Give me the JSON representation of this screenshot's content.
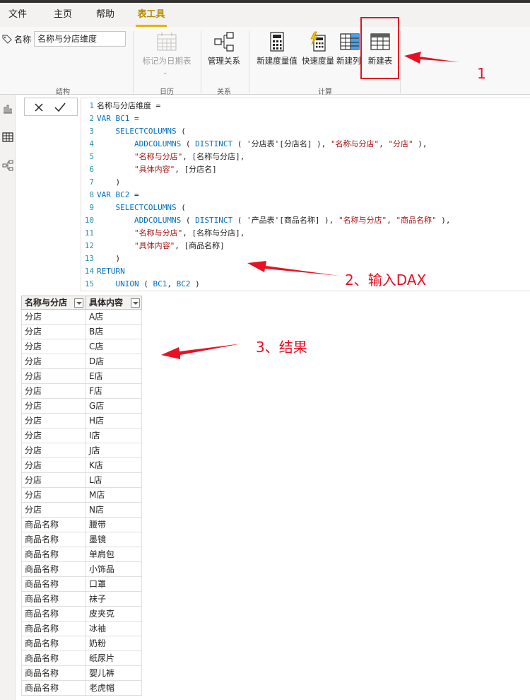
{
  "tabs": [
    {
      "label": "文件"
    },
    {
      "label": "主页"
    },
    {
      "label": "帮助"
    },
    {
      "label": "表工具"
    }
  ],
  "ribbon": {
    "name_label": "名称",
    "name_value": "名称与分店维度",
    "buttons": {
      "mark_date_table": "标记为日期表",
      "manage_relations": "管理关系",
      "new_measure": "新建度量值",
      "quick_measure": "快速度量",
      "new_column": "新建列",
      "new_table": "新建表"
    },
    "groups": {
      "structure": "结构",
      "calendar": "日历",
      "relations": "关系",
      "calc": "计算"
    }
  },
  "editor": {
    "lines": [
      {
        "n": "1",
        "text": "名称与分店维度 ="
      },
      {
        "n": "2",
        "text": "VAR BC1 ="
      },
      {
        "n": "3",
        "text": "    SELECTCOLUMNS ("
      },
      {
        "n": "4",
        "text": "        ADDCOLUMNS ( DISTINCT ( '分店表'[分店名] ), \"名称与分店\", \"分店\" ),"
      },
      {
        "n": "5",
        "text": "        \"名称与分店\", [名称与分店],"
      },
      {
        "n": "6",
        "text": "        \"具体内容\", [分店名]"
      },
      {
        "n": "7",
        "text": "    )"
      },
      {
        "n": "8",
        "text": "VAR BC2 ="
      },
      {
        "n": "9",
        "text": "    SELECTCOLUMNS ("
      },
      {
        "n": "10",
        "text": "        ADDCOLUMNS ( DISTINCT ( '产品表'[商品名称] ), \"名称与分店\", \"商品名称\" ),"
      },
      {
        "n": "11",
        "text": "        \"名称与分店\", [名称与分店],"
      },
      {
        "n": "12",
        "text": "        \"具体内容\", [商品名称]"
      },
      {
        "n": "13",
        "text": "    )"
      },
      {
        "n": "14",
        "text": "RETURN"
      },
      {
        "n": "15",
        "text": "    UNION ( BC1, BC2 )"
      }
    ]
  },
  "table": {
    "columns": [
      "名称与分店",
      "具体内容"
    ],
    "rows": [
      [
        "分店",
        "A店"
      ],
      [
        "分店",
        "B店"
      ],
      [
        "分店",
        "C店"
      ],
      [
        "分店",
        "D店"
      ],
      [
        "分店",
        "E店"
      ],
      [
        "分店",
        "F店"
      ],
      [
        "分店",
        "G店"
      ],
      [
        "分店",
        "H店"
      ],
      [
        "分店",
        "I店"
      ],
      [
        "分店",
        "J店"
      ],
      [
        "分店",
        "K店"
      ],
      [
        "分店",
        "L店"
      ],
      [
        "分店",
        "M店"
      ],
      [
        "分店",
        "N店"
      ],
      [
        "商品名称",
        "腰带"
      ],
      [
        "商品名称",
        "墨镜"
      ],
      [
        "商品名称",
        "单肩包"
      ],
      [
        "商品名称",
        "小饰品"
      ],
      [
        "商品名称",
        "口罩"
      ],
      [
        "商品名称",
        "袜子"
      ],
      [
        "商品名称",
        "皮夹克"
      ],
      [
        "商品名称",
        "冰袖"
      ],
      [
        "商品名称",
        "奶粉"
      ],
      [
        "商品名称",
        "纸尿片"
      ],
      [
        "商品名称",
        "婴儿裤"
      ],
      [
        "商品名称",
        "老虎帽"
      ]
    ]
  },
  "annotations": {
    "step1": "1",
    "step2": "2、输入DAX",
    "step3": "3、结果"
  },
  "colors": {
    "accent": "#e8b400",
    "annotation": "#e81123",
    "keyword": "#0070c1",
    "string": "#a31515"
  }
}
